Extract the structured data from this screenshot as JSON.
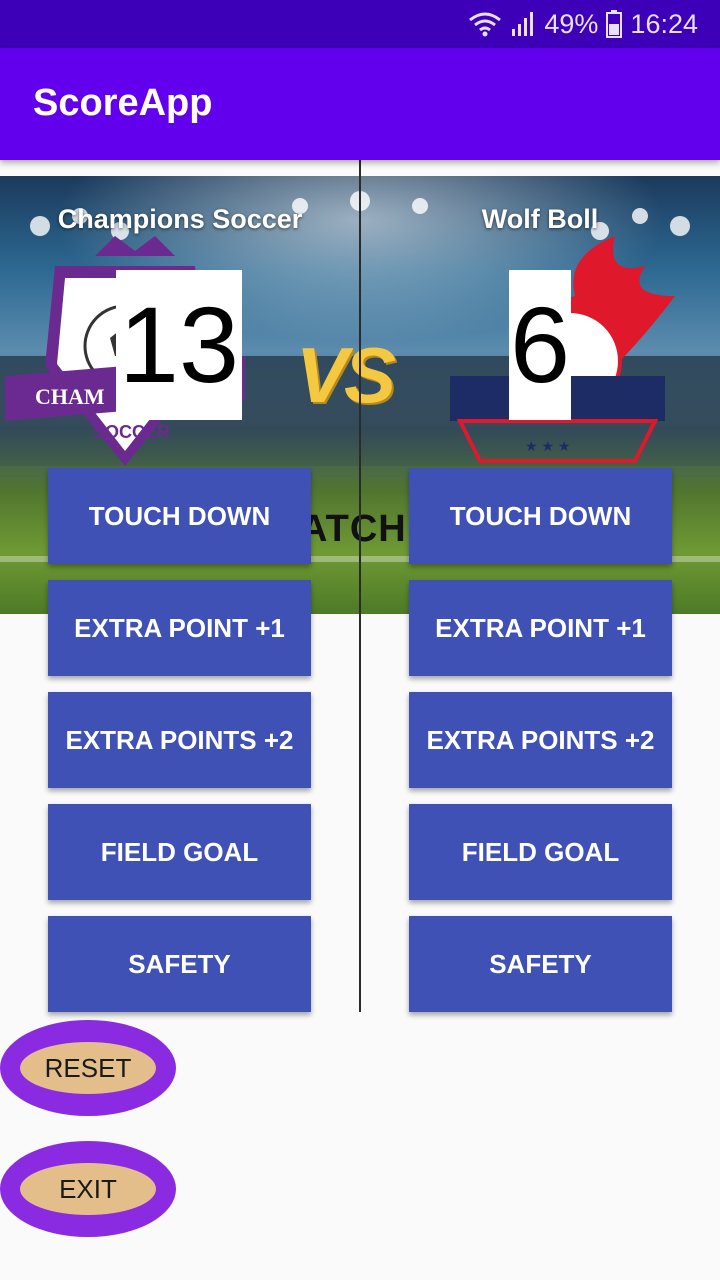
{
  "status_bar": {
    "battery_percent": "49%",
    "time": "16:24",
    "icons": [
      "wifi-icon",
      "signal-icon",
      "battery-icon"
    ]
  },
  "app": {
    "title": "ScoreApp"
  },
  "hero": {
    "vs_text": "VS",
    "banner_text": "ATCH!"
  },
  "team_a": {
    "name": "Champions Soccer",
    "score": "13",
    "logo_text": "CHAM",
    "logo_subtext": "SOCCER",
    "buttons": [
      "TOUCH DOWN",
      "EXTRA POINT +1",
      "EXTRA POINTS +2",
      "FIELD GOAL",
      "SAFETY"
    ]
  },
  "team_b": {
    "name": "Wolf Boll",
    "score": "6",
    "buttons": [
      "TOUCH DOWN",
      "EXTRA POINT +1",
      "EXTRA POINTS +2",
      "FIELD GOAL",
      "SAFETY"
    ]
  },
  "actions": {
    "reset_label": "RESET",
    "exit_label": "EXIT"
  },
  "colors": {
    "status_bar": "#3d00b8",
    "app_bar": "#6200ee",
    "button": "#3f51b5",
    "oval_outer": "#8a2be2",
    "oval_inner": "#e3bd8a"
  }
}
